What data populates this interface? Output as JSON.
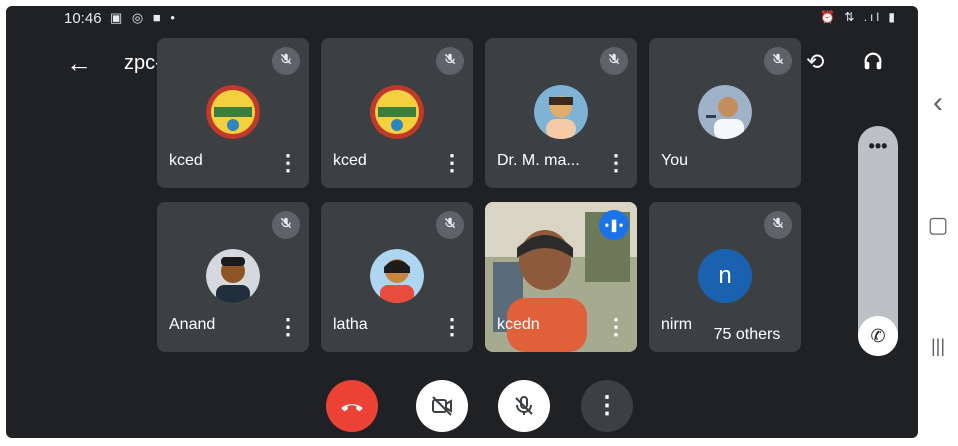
{
  "status_bar": {
    "time": "10:46",
    "left_icons": "▣ ◎ ■ •",
    "right_icons": "⏰ ⇅ .ıl ▮"
  },
  "header": {
    "meeting_code": "zpc-dbvp-smz",
    "back_icon": "arrow-left-icon",
    "right_icons": [
      "camera-switch-icon",
      "headphones-icon"
    ]
  },
  "tiles": [
    {
      "name": "kced",
      "muted": true
    },
    {
      "name": "kced",
      "muted": true
    },
    {
      "name": "Dr. M. ma...",
      "muted": true
    },
    {
      "name": "You",
      "muted": true
    },
    {
      "name": "Anand",
      "muted": true
    },
    {
      "name": "latha",
      "muted": true
    },
    {
      "name": "kcedn",
      "muted": false,
      "speaking": true
    },
    {
      "name": "nirm",
      "muted": true,
      "avatar_letter": "n"
    }
  ],
  "overflow": {
    "label": "75 others"
  },
  "controls": {
    "end_call": "end-call-icon",
    "camera": "camera-off-icon",
    "mic": "mic-off-icon",
    "more": "more-options-icon"
  },
  "colors": {
    "background": "#202124",
    "tile": "#3c4043",
    "end_call": "#ea4335",
    "speaking": "#1a73e8",
    "avatar_n": "#1a62b0"
  },
  "nav": {
    "back": "‹",
    "home": "▢",
    "recents": "|||"
  }
}
